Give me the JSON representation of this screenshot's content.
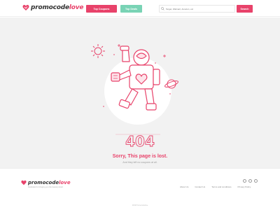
{
  "header": {
    "logo": {
      "part1": "promocode",
      "part2": "love"
    },
    "top_coupons_label": "Top Coupons",
    "top_deals_label": "Top Deals",
    "search_placeholder": "Target, Walmart, Amazon, etc",
    "search_button_label": "Search"
  },
  "main": {
    "error_code": "404",
    "title": "Sorry, This page is lost.",
    "subtitle": "And they left no coupons at all."
  },
  "footer": {
    "logo": {
      "part1": "promocode",
      "part2": "love"
    },
    "tagline": "Dedicated to bringing you the lowest prices!",
    "links": [
      "About Us",
      "Contact Us",
      "Terms and conditions",
      "Privacy Policy"
    ],
    "social": [
      "facebook-icon",
      "twitter-icon",
      "instagram-icon"
    ],
    "copyright": "2019 Promocodelove"
  },
  "colors": {
    "brand_pink": "#e8426a",
    "mint": "#79d3b5",
    "background_grey": "#f2f2f2"
  }
}
